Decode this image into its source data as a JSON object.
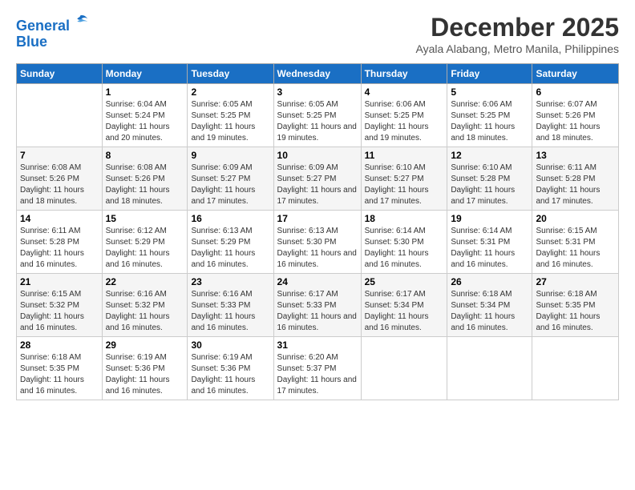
{
  "logo": {
    "line1": "General",
    "line2": "Blue"
  },
  "title": "December 2025",
  "location": "Ayala Alabang, Metro Manila, Philippines",
  "days_header": [
    "Sunday",
    "Monday",
    "Tuesday",
    "Wednesday",
    "Thursday",
    "Friday",
    "Saturday"
  ],
  "weeks": [
    [
      {
        "day": "",
        "sunrise": "",
        "sunset": "",
        "daylight": ""
      },
      {
        "day": "1",
        "sunrise": "Sunrise: 6:04 AM",
        "sunset": "Sunset: 5:24 PM",
        "daylight": "Daylight: 11 hours and 20 minutes."
      },
      {
        "day": "2",
        "sunrise": "Sunrise: 6:05 AM",
        "sunset": "Sunset: 5:25 PM",
        "daylight": "Daylight: 11 hours and 19 minutes."
      },
      {
        "day": "3",
        "sunrise": "Sunrise: 6:05 AM",
        "sunset": "Sunset: 5:25 PM",
        "daylight": "Daylight: 11 hours and 19 minutes."
      },
      {
        "day": "4",
        "sunrise": "Sunrise: 6:06 AM",
        "sunset": "Sunset: 5:25 PM",
        "daylight": "Daylight: 11 hours and 19 minutes."
      },
      {
        "day": "5",
        "sunrise": "Sunrise: 6:06 AM",
        "sunset": "Sunset: 5:25 PM",
        "daylight": "Daylight: 11 hours and 18 minutes."
      },
      {
        "day": "6",
        "sunrise": "Sunrise: 6:07 AM",
        "sunset": "Sunset: 5:26 PM",
        "daylight": "Daylight: 11 hours and 18 minutes."
      }
    ],
    [
      {
        "day": "7",
        "sunrise": "Sunrise: 6:08 AM",
        "sunset": "Sunset: 5:26 PM",
        "daylight": "Daylight: 11 hours and 18 minutes."
      },
      {
        "day": "8",
        "sunrise": "Sunrise: 6:08 AM",
        "sunset": "Sunset: 5:26 PM",
        "daylight": "Daylight: 11 hours and 18 minutes."
      },
      {
        "day": "9",
        "sunrise": "Sunrise: 6:09 AM",
        "sunset": "Sunset: 5:27 PM",
        "daylight": "Daylight: 11 hours and 17 minutes."
      },
      {
        "day": "10",
        "sunrise": "Sunrise: 6:09 AM",
        "sunset": "Sunset: 5:27 PM",
        "daylight": "Daylight: 11 hours and 17 minutes."
      },
      {
        "day": "11",
        "sunrise": "Sunrise: 6:10 AM",
        "sunset": "Sunset: 5:27 PM",
        "daylight": "Daylight: 11 hours and 17 minutes."
      },
      {
        "day": "12",
        "sunrise": "Sunrise: 6:10 AM",
        "sunset": "Sunset: 5:28 PM",
        "daylight": "Daylight: 11 hours and 17 minutes."
      },
      {
        "day": "13",
        "sunrise": "Sunrise: 6:11 AM",
        "sunset": "Sunset: 5:28 PM",
        "daylight": "Daylight: 11 hours and 17 minutes."
      }
    ],
    [
      {
        "day": "14",
        "sunrise": "Sunrise: 6:11 AM",
        "sunset": "Sunset: 5:28 PM",
        "daylight": "Daylight: 11 hours and 16 minutes."
      },
      {
        "day": "15",
        "sunrise": "Sunrise: 6:12 AM",
        "sunset": "Sunset: 5:29 PM",
        "daylight": "Daylight: 11 hours and 16 minutes."
      },
      {
        "day": "16",
        "sunrise": "Sunrise: 6:13 AM",
        "sunset": "Sunset: 5:29 PM",
        "daylight": "Daylight: 11 hours and 16 minutes."
      },
      {
        "day": "17",
        "sunrise": "Sunrise: 6:13 AM",
        "sunset": "Sunset: 5:30 PM",
        "daylight": "Daylight: 11 hours and 16 minutes."
      },
      {
        "day": "18",
        "sunrise": "Sunrise: 6:14 AM",
        "sunset": "Sunset: 5:30 PM",
        "daylight": "Daylight: 11 hours and 16 minutes."
      },
      {
        "day": "19",
        "sunrise": "Sunrise: 6:14 AM",
        "sunset": "Sunset: 5:31 PM",
        "daylight": "Daylight: 11 hours and 16 minutes."
      },
      {
        "day": "20",
        "sunrise": "Sunrise: 6:15 AM",
        "sunset": "Sunset: 5:31 PM",
        "daylight": "Daylight: 11 hours and 16 minutes."
      }
    ],
    [
      {
        "day": "21",
        "sunrise": "Sunrise: 6:15 AM",
        "sunset": "Sunset: 5:32 PM",
        "daylight": "Daylight: 11 hours and 16 minutes."
      },
      {
        "day": "22",
        "sunrise": "Sunrise: 6:16 AM",
        "sunset": "Sunset: 5:32 PM",
        "daylight": "Daylight: 11 hours and 16 minutes."
      },
      {
        "day": "23",
        "sunrise": "Sunrise: 6:16 AM",
        "sunset": "Sunset: 5:33 PM",
        "daylight": "Daylight: 11 hours and 16 minutes."
      },
      {
        "day": "24",
        "sunrise": "Sunrise: 6:17 AM",
        "sunset": "Sunset: 5:33 PM",
        "daylight": "Daylight: 11 hours and 16 minutes."
      },
      {
        "day": "25",
        "sunrise": "Sunrise: 6:17 AM",
        "sunset": "Sunset: 5:34 PM",
        "daylight": "Daylight: 11 hours and 16 minutes."
      },
      {
        "day": "26",
        "sunrise": "Sunrise: 6:18 AM",
        "sunset": "Sunset: 5:34 PM",
        "daylight": "Daylight: 11 hours and 16 minutes."
      },
      {
        "day": "27",
        "sunrise": "Sunrise: 6:18 AM",
        "sunset": "Sunset: 5:35 PM",
        "daylight": "Daylight: 11 hours and 16 minutes."
      }
    ],
    [
      {
        "day": "28",
        "sunrise": "Sunrise: 6:18 AM",
        "sunset": "Sunset: 5:35 PM",
        "daylight": "Daylight: 11 hours and 16 minutes."
      },
      {
        "day": "29",
        "sunrise": "Sunrise: 6:19 AM",
        "sunset": "Sunset: 5:36 PM",
        "daylight": "Daylight: 11 hours and 16 minutes."
      },
      {
        "day": "30",
        "sunrise": "Sunrise: 6:19 AM",
        "sunset": "Sunset: 5:36 PM",
        "daylight": "Daylight: 11 hours and 16 minutes."
      },
      {
        "day": "31",
        "sunrise": "Sunrise: 6:20 AM",
        "sunset": "Sunset: 5:37 PM",
        "daylight": "Daylight: 11 hours and 17 minutes."
      },
      {
        "day": "",
        "sunrise": "",
        "sunset": "",
        "daylight": ""
      },
      {
        "day": "",
        "sunrise": "",
        "sunset": "",
        "daylight": ""
      },
      {
        "day": "",
        "sunrise": "",
        "sunset": "",
        "daylight": ""
      }
    ]
  ]
}
